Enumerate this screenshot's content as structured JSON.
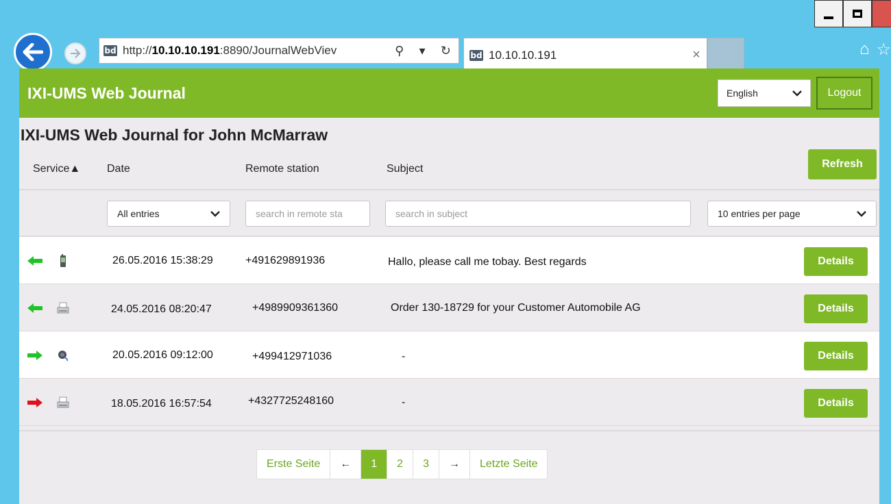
{
  "browser": {
    "url_prefix": "http://",
    "url_host": "10.10.10.191",
    "url_rest": ":8890/JournalWebViev",
    "tab_title": "10.10.10.191",
    "favicon_text": "bd"
  },
  "app": {
    "brand": "IXI-UMS Web Journal",
    "language": "English",
    "logout_label": "Logout",
    "page_title": "IXI-UMS Web Journal for John McMarraw",
    "accent_color": "#7fb927"
  },
  "columns": {
    "service": "Service▲",
    "date": "Date",
    "remote": "Remote station",
    "subject": "Subject",
    "refresh_label": "Refresh"
  },
  "filters": {
    "entry_type": "All entries",
    "remote_placeholder": "search in remote sta",
    "subject_placeholder": "search in subject",
    "per_page": "10 entries per page"
  },
  "rows": [
    {
      "direction": "incoming",
      "service": "sms-icon",
      "date": "26.05.2016 15:38:29",
      "remote": "+491629891936",
      "subject": "Hallo, please call me tobay. Best regards",
      "details_label": "Details"
    },
    {
      "direction": "incoming",
      "service": "fax-icon",
      "date": "24.05.2016 08:20:47",
      "remote": "+4989909361360",
      "subject": "Order 130-18729 for your Customer Automobile AG",
      "details_label": "Details"
    },
    {
      "direction": "outgoing",
      "service": "voice-icon",
      "date": "20.05.2016 09:12:00",
      "remote": "+499412971036",
      "subject": "-",
      "details_label": "Details"
    },
    {
      "direction": "outgoing-failed",
      "service": "fax-icon",
      "date": "18.05.2016 16:57:54",
      "remote": "+4327725248160",
      "subject": "-",
      "details_label": "Details"
    }
  ],
  "pagination": {
    "first": "Erste Seite",
    "prev": "←",
    "pages": [
      "1",
      "2",
      "3"
    ],
    "active_page": "1",
    "next": "→",
    "last": "Letzte Seite"
  }
}
